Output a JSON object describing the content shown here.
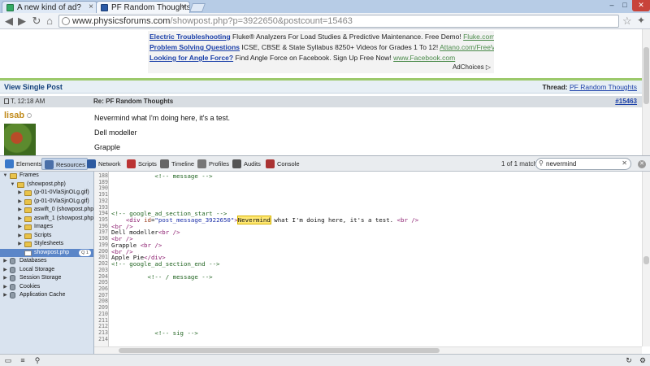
{
  "browser": {
    "tabs": [
      {
        "title": "A new kind of ad?"
      },
      {
        "title": "PF Random Thoughts - Sin"
      }
    ],
    "address": {
      "host": "www.physicsforums.com",
      "path": "/showpost.php?p=3922650&postcount=15463"
    }
  },
  "ads": [
    {
      "headline": "Electric Troubleshooting",
      "text": "Fluke® Analyzers For Load Studies & Predictive Maintenance. Free Demo!",
      "url": "Fluke.com/Electric_Troubl"
    },
    {
      "headline": "Problem Solving Questions",
      "text": "ICSE, CBSE & State Syllabus 8250+ Videos for Grades 1 To 12!",
      "url": "Attano.com/FreeVideos"
    },
    {
      "headline": "Looking for Angle Force?",
      "text": "Find Angle Force on Facebook. Sign Up Free Now!",
      "url": "www.Facebook.com"
    }
  ],
  "adchoices": "AdChoices ▷",
  "page": {
    "view_title": "View Single Post",
    "thread_label": "Thread:",
    "thread_name": "PF Random Thoughts",
    "post_date": "T, 12:18 AM",
    "post_title": "Re: PF Random Thoughts",
    "post_number": "#15463",
    "username": "lisab",
    "body": [
      "Nevermind what I'm doing here, it's a test.",
      "Dell modeller",
      "Grapple"
    ]
  },
  "devtools": {
    "tabs": [
      {
        "label": "Elements",
        "color": "#3b79c9"
      },
      {
        "label": "Resources",
        "color": "#4a6fa8"
      },
      {
        "label": "Network",
        "color": "#2d5aa0"
      },
      {
        "label": "Scripts",
        "color": "#b33"
      },
      {
        "label": "Timeline",
        "color": "#666"
      },
      {
        "label": "Profiles",
        "color": "#777"
      },
      {
        "label": "Audits",
        "color": "#555"
      },
      {
        "label": "Console",
        "color": "#a33"
      }
    ],
    "active_tab": "Resources",
    "match_text": "1 of 1 match",
    "search_value": "nevermind",
    "tree": [
      {
        "label": "Frames",
        "indent": 0,
        "tw": "▼",
        "icon": "folder"
      },
      {
        "label": "(showpost.php)",
        "indent": 1,
        "tw": "▼",
        "icon": "folder"
      },
      {
        "label": "(p-01-0VlaSjnOLg.gif)",
        "indent": 2,
        "tw": "▶",
        "icon": "folder"
      },
      {
        "label": "(p-01-0VlaSjnOLg.gif)",
        "indent": 2,
        "tw": "▶",
        "icon": "folder"
      },
      {
        "label": "aswift_0 (showpost.php)",
        "indent": 2,
        "tw": "▶",
        "icon": "folder"
      },
      {
        "label": "aswift_1 (showpost.php)",
        "indent": 2,
        "tw": "▶",
        "icon": "folder"
      },
      {
        "label": "Images",
        "indent": 2,
        "tw": "▶",
        "icon": "folder"
      },
      {
        "label": "Scripts",
        "indent": 2,
        "tw": "▶",
        "icon": "folder"
      },
      {
        "label": "Stylesheets",
        "indent": 2,
        "tw": "▶",
        "icon": "folder"
      },
      {
        "label": "showpost.php",
        "indent": 2,
        "tw": "",
        "icon": "doc",
        "selected": true,
        "badge": "Q 1"
      },
      {
        "label": "Databases",
        "indent": 0,
        "tw": "▶",
        "icon": "db"
      },
      {
        "label": "Local Storage",
        "indent": 0,
        "tw": "▶",
        "icon": "db"
      },
      {
        "label": "Session Storage",
        "indent": 0,
        "tw": "▶",
        "icon": "db"
      },
      {
        "label": "Cookies",
        "indent": 0,
        "tw": "▶",
        "icon": "db"
      },
      {
        "label": "Application Cache",
        "indent": 0,
        "tw": "▶",
        "icon": "db"
      }
    ],
    "code": [
      {
        "n": "188",
        "parts": [
          {
            "t": "            ",
            "k": ""
          },
          {
            "t": "<!-- message -->",
            "k": "c"
          }
        ]
      },
      {
        "n": "189",
        "parts": []
      },
      {
        "n": "190",
        "parts": []
      },
      {
        "n": "191",
        "parts": []
      },
      {
        "n": "192",
        "parts": []
      },
      {
        "n": "193",
        "parts": []
      },
      {
        "n": "194",
        "parts": [
          {
            "t": "<!-- google_ad_section_start -->",
            "k": "c"
          }
        ]
      },
      {
        "n": "195",
        "parts": [
          {
            "t": "    ",
            "k": ""
          },
          {
            "t": "<div ",
            "k": "t"
          },
          {
            "t": "id",
            "k": "a"
          },
          {
            "t": "=",
            "k": ""
          },
          {
            "t": "\"post_message_3922650\"",
            "k": "v"
          },
          {
            "t": ">",
            "k": "t"
          },
          {
            "t": "Nevermind",
            "k": "hl"
          },
          {
            "t": " what I'm doing here, it's a test. ",
            "k": ""
          },
          {
            "t": "<br />",
            "k": "t"
          }
        ]
      },
      {
        "n": "196",
        "parts": [
          {
            "t": "<br />",
            "k": "t"
          }
        ]
      },
      {
        "n": "197",
        "parts": [
          {
            "t": "Dell modeller",
            "k": ""
          },
          {
            "t": "<br />",
            "k": "t"
          }
        ]
      },
      {
        "n": "198",
        "parts": [
          {
            "t": "<br />",
            "k": "t"
          }
        ]
      },
      {
        "n": "199",
        "parts": [
          {
            "t": "Grapple ",
            "k": ""
          },
          {
            "t": "<br />",
            "k": "t"
          }
        ]
      },
      {
        "n": "200",
        "parts": [
          {
            "t": "<br />",
            "k": "t"
          }
        ]
      },
      {
        "n": "201",
        "parts": [
          {
            "t": "Apple Pie",
            "k": ""
          },
          {
            "t": "</div>",
            "k": "t"
          }
        ]
      },
      {
        "n": "202",
        "parts": [
          {
            "t": "<!-- google_ad_section_end -->",
            "k": "c"
          }
        ]
      },
      {
        "n": "203",
        "parts": []
      },
      {
        "n": "204",
        "parts": [
          {
            "t": "          ",
            "k": ""
          },
          {
            "t": "<!-- / message -->",
            "k": "c"
          }
        ]
      },
      {
        "n": "205",
        "parts": []
      },
      {
        "n": "206",
        "parts": []
      },
      {
        "n": "207",
        "parts": []
      },
      {
        "n": "208",
        "parts": []
      },
      {
        "n": "209",
        "parts": []
      },
      {
        "n": "210",
        "parts": []
      },
      {
        "n": "211",
        "parts": []
      },
      {
        "n": "212",
        "parts": []
      },
      {
        "n": "213",
        "parts": [
          {
            "t": "            ",
            "k": ""
          },
          {
            "t": "<!-- sig -->",
            "k": "c"
          }
        ]
      },
      {
        "n": "214",
        "parts": []
      }
    ]
  }
}
